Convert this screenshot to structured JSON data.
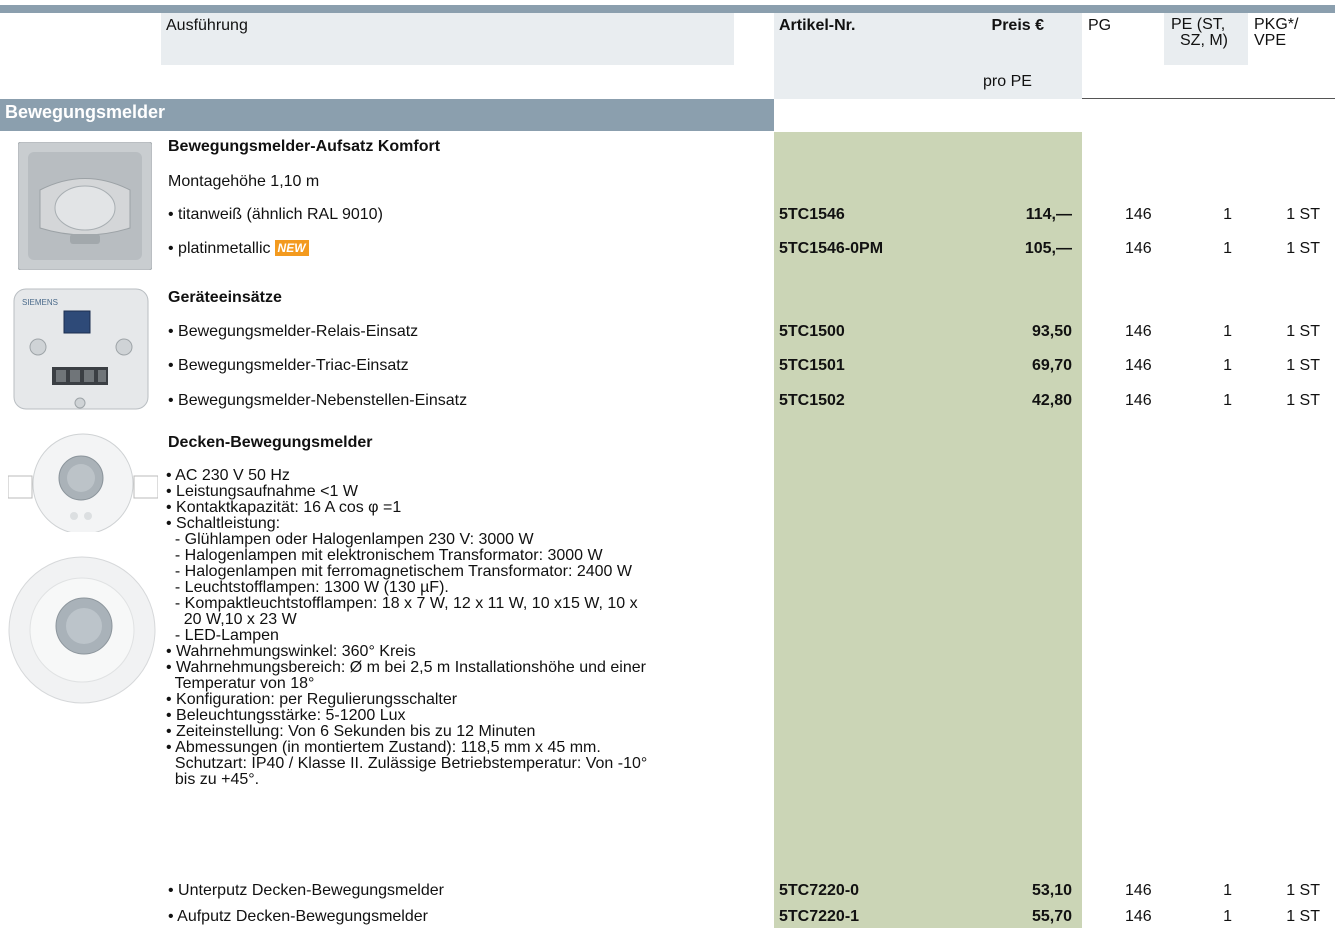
{
  "header": {
    "ausfuehrung": "Ausführung",
    "artikel": "Artikel-Nr.",
    "preis": "Preis €",
    "pro_pe": "pro PE",
    "pg": "PG",
    "pe_line1": "PE (ST,",
    "pe_line2": "SZ, M)",
    "pkg_line1": "PKG*/",
    "pkg_line2": "VPE"
  },
  "section": {
    "title": "Bewegungsmelder"
  },
  "groups": [
    {
      "title": "Bewegungsmelder-Aufsatz Komfort",
      "subtitle": "Montagehöhe 1,10 m",
      "items": [
        {
          "label": "• titanweiß (ähnlich RAL 9010)",
          "article": "5TC1546",
          "price": "114,—",
          "pg": "146",
          "pe": "1",
          "pkg": "1 ST"
        },
        {
          "label": "• platinmetallic",
          "badge": "NEW",
          "article": "5TC1546-0PM",
          "price": "105,—",
          "pg": "146",
          "pe": "1",
          "pkg": "1 ST"
        }
      ]
    },
    {
      "title": "Geräteeinsätze",
      "items": [
        {
          "label": "• Bewegungsmelder-Relais-Einsatz",
          "article": "5TC1500",
          "price": "93,50",
          "pg": "146",
          "pe": "1",
          "pkg": "1 ST"
        },
        {
          "label": "• Bewegungsmelder-Triac-Einsatz",
          "article": "5TC1501",
          "price": "69,70",
          "pg": "146",
          "pe": "1",
          "pkg": "1 ST"
        },
        {
          "label": "• Bewegungsmelder-Nebenstellen-Einsatz",
          "article": "5TC1502",
          "price": "42,80",
          "pg": "146",
          "pe": "1",
          "pkg": "1 ST"
        }
      ]
    },
    {
      "title": "Decken-Bewegungsmelder",
      "spec_lines": [
        "• AC 230 V 50 Hz",
        "• Leistungsaufnahme <1 W",
        "• Kontaktkapazität: 16 A cos φ =1",
        "• Schaltleistung:",
        "  - Glühlampen oder Halogenlampen 230 V: 3000 W",
        "  - Halogenlampen mit elektronischem Transformator: 3000 W",
        "  - Halogenlampen mit ferromagnetischem Transformator: 2400 W",
        "  - Leuchtstofflampen: 1300 W (130 µF).",
        "  - Kompaktleuchtstofflampen: 18 x 7 W, 12 x 11 W, 10 x15 W, 10 x",
        "    20 W,10 x 23 W",
        "  - LED-Lampen",
        "• Wahrnehmungswinkel: 360° Kreis",
        "• Wahrnehmungsbereich: Ø m bei 2,5 m Installationshöhe und einer",
        "  Temperatur von 18°",
        "• Konfiguration: per Regulierungsschalter",
        "• Beleuchtungsstärke: 5-1200 Lux",
        "• Zeiteinstellung: Von 6 Sekunden bis zu 12 Minuten",
        "• Abmessungen (in montiertem Zustand): 118,5 mm x 45 mm.",
        "  Schutzart: IP40 / Klasse II. Zulässige Betriebstemperatur: Von -10°",
        "  bis zu +45°."
      ],
      "items": [
        {
          "label": "• Unterputz Decken-Bewegungsmelder",
          "article": "5TC7220-0",
          "price": "53,10",
          "pg": "146",
          "pe": "1",
          "pkg": "1 ST"
        },
        {
          "label": "• Aufputz Decken-Bewegungsmelder",
          "article": "5TC7220-1",
          "price": "55,70",
          "pg": "146",
          "pe": "1",
          "pkg": "1 ST"
        }
      ]
    }
  ],
  "device_insert_text": "SIEMENS",
  "colors": {
    "header_bar": "#8b9fae",
    "header_bg": "#e9edf0",
    "price_column": "#cbd5b6",
    "new_badge": "#f39a1e"
  }
}
